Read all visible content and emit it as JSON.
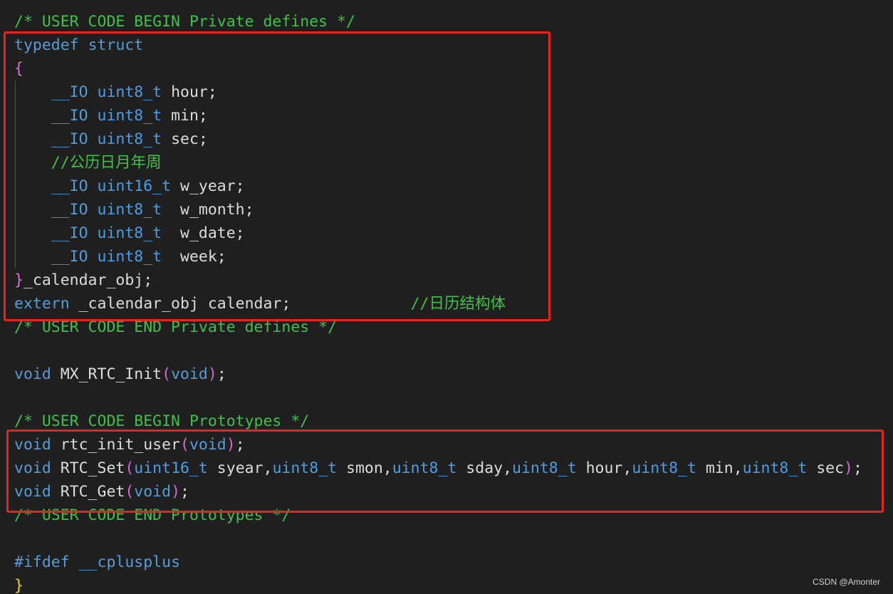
{
  "colors": {
    "background": "#1f1f1f",
    "comment": "#3ec24a",
    "keyword": "#569cd6",
    "type": "#4a9ee8",
    "identifier": "#dcdcdc",
    "bracket_magenta": "#da70d6",
    "bracket_gold": "#ffd700",
    "highlight_box": "#e8231e"
  },
  "code_lines": [
    [
      {
        "t": "comment",
        "v": "/* USER CODE BEGIN Private defines */"
      }
    ],
    [
      {
        "t": "keyword",
        "v": "typedef"
      },
      {
        "t": "plain",
        "v": " "
      },
      {
        "t": "keyword",
        "v": "struct"
      }
    ],
    [
      {
        "t": "brace",
        "v": "{"
      }
    ],
    [
      {
        "t": "plain",
        "v": "    "
      },
      {
        "t": "macro",
        "v": "__IO"
      },
      {
        "t": "plain",
        "v": " "
      },
      {
        "t": "type",
        "v": "uint8_t"
      },
      {
        "t": "plain",
        "v": " hour;"
      }
    ],
    [
      {
        "t": "plain",
        "v": "    "
      },
      {
        "t": "macro",
        "v": "__IO"
      },
      {
        "t": "plain",
        "v": " "
      },
      {
        "t": "type",
        "v": "uint8_t"
      },
      {
        "t": "plain",
        "v": " min;"
      }
    ],
    [
      {
        "t": "plain",
        "v": "    "
      },
      {
        "t": "macro",
        "v": "__IO"
      },
      {
        "t": "plain",
        "v": " "
      },
      {
        "t": "type",
        "v": "uint8_t"
      },
      {
        "t": "plain",
        "v": " sec;"
      }
    ],
    [
      {
        "t": "plain",
        "v": "    "
      },
      {
        "t": "comment",
        "v": "//公历日月年周"
      }
    ],
    [
      {
        "t": "plain",
        "v": "    "
      },
      {
        "t": "macro",
        "v": "__IO"
      },
      {
        "t": "plain",
        "v": " "
      },
      {
        "t": "type",
        "v": "uint16_t"
      },
      {
        "t": "plain",
        "v": " w_year;"
      }
    ],
    [
      {
        "t": "plain",
        "v": "    "
      },
      {
        "t": "macro",
        "v": "__IO"
      },
      {
        "t": "plain",
        "v": " "
      },
      {
        "t": "type",
        "v": "uint8_t"
      },
      {
        "t": "plain",
        "v": "  w_month;"
      }
    ],
    [
      {
        "t": "plain",
        "v": "    "
      },
      {
        "t": "macro",
        "v": "__IO"
      },
      {
        "t": "plain",
        "v": " "
      },
      {
        "t": "type",
        "v": "uint8_t"
      },
      {
        "t": "plain",
        "v": "  w_date;"
      }
    ],
    [
      {
        "t": "plain",
        "v": "    "
      },
      {
        "t": "macro",
        "v": "__IO"
      },
      {
        "t": "plain",
        "v": " "
      },
      {
        "t": "type",
        "v": "uint8_t"
      },
      {
        "t": "plain",
        "v": "  week;"
      }
    ],
    [
      {
        "t": "brace",
        "v": "}"
      },
      {
        "t": "plain",
        "v": "_calendar_obj;"
      }
    ],
    [
      {
        "t": "keyword",
        "v": "extern"
      },
      {
        "t": "plain",
        "v": " _calendar_obj calendar;             "
      },
      {
        "t": "comment",
        "v": "//日历结构体"
      }
    ],
    [
      {
        "t": "comment",
        "v": "/* USER CODE END Private defines */"
      }
    ],
    [
      {
        "t": "plain",
        "v": ""
      }
    ],
    [
      {
        "t": "keyword",
        "v": "void"
      },
      {
        "t": "plain",
        "v": " MX_RTC_Init"
      },
      {
        "t": "paren",
        "v": "("
      },
      {
        "t": "keyword",
        "v": "void"
      },
      {
        "t": "paren",
        "v": ")"
      },
      {
        "t": "plain",
        "v": ";"
      }
    ],
    [
      {
        "t": "plain",
        "v": ""
      }
    ],
    [
      {
        "t": "comment",
        "v": "/* USER CODE BEGIN Prototypes */"
      }
    ],
    [
      {
        "t": "keyword",
        "v": "void"
      },
      {
        "t": "plain",
        "v": " rtc_init_user"
      },
      {
        "t": "paren",
        "v": "("
      },
      {
        "t": "keyword",
        "v": "void"
      },
      {
        "t": "paren",
        "v": ")"
      },
      {
        "t": "plain",
        "v": ";"
      }
    ],
    [
      {
        "t": "keyword",
        "v": "void"
      },
      {
        "t": "plain",
        "v": " RTC_Set"
      },
      {
        "t": "paren",
        "v": "("
      },
      {
        "t": "type",
        "v": "uint16_t"
      },
      {
        "t": "plain",
        "v": " syear,"
      },
      {
        "t": "type",
        "v": "uint8_t"
      },
      {
        "t": "plain",
        "v": " smon,"
      },
      {
        "t": "type",
        "v": "uint8_t"
      },
      {
        "t": "plain",
        "v": " sday,"
      },
      {
        "t": "type",
        "v": "uint8_t"
      },
      {
        "t": "plain",
        "v": " hour,"
      },
      {
        "t": "type",
        "v": "uint8_t"
      },
      {
        "t": "plain",
        "v": " min,"
      },
      {
        "t": "type",
        "v": "uint8_t"
      },
      {
        "t": "plain",
        "v": " sec"
      },
      {
        "t": "paren",
        "v": ")"
      },
      {
        "t": "plain",
        "v": ";"
      }
    ],
    [
      {
        "t": "keyword",
        "v": "void"
      },
      {
        "t": "plain",
        "v": " RTC_Get"
      },
      {
        "t": "paren",
        "v": "("
      },
      {
        "t": "keyword",
        "v": "void"
      },
      {
        "t": "paren",
        "v": ")"
      },
      {
        "t": "plain",
        "v": ";"
      }
    ],
    [
      {
        "t": "comment",
        "v": "/* USER CODE END Prototypes */"
      }
    ],
    [
      {
        "t": "plain",
        "v": ""
      }
    ],
    [
      {
        "t": "keyword",
        "v": "#ifdef"
      },
      {
        "t": "plain",
        "v": " "
      },
      {
        "t": "keyword",
        "v": "__cplusplus"
      }
    ],
    [
      {
        "t": "gold",
        "v": "}"
      }
    ]
  ],
  "watermark": "CSDN @Amonter"
}
